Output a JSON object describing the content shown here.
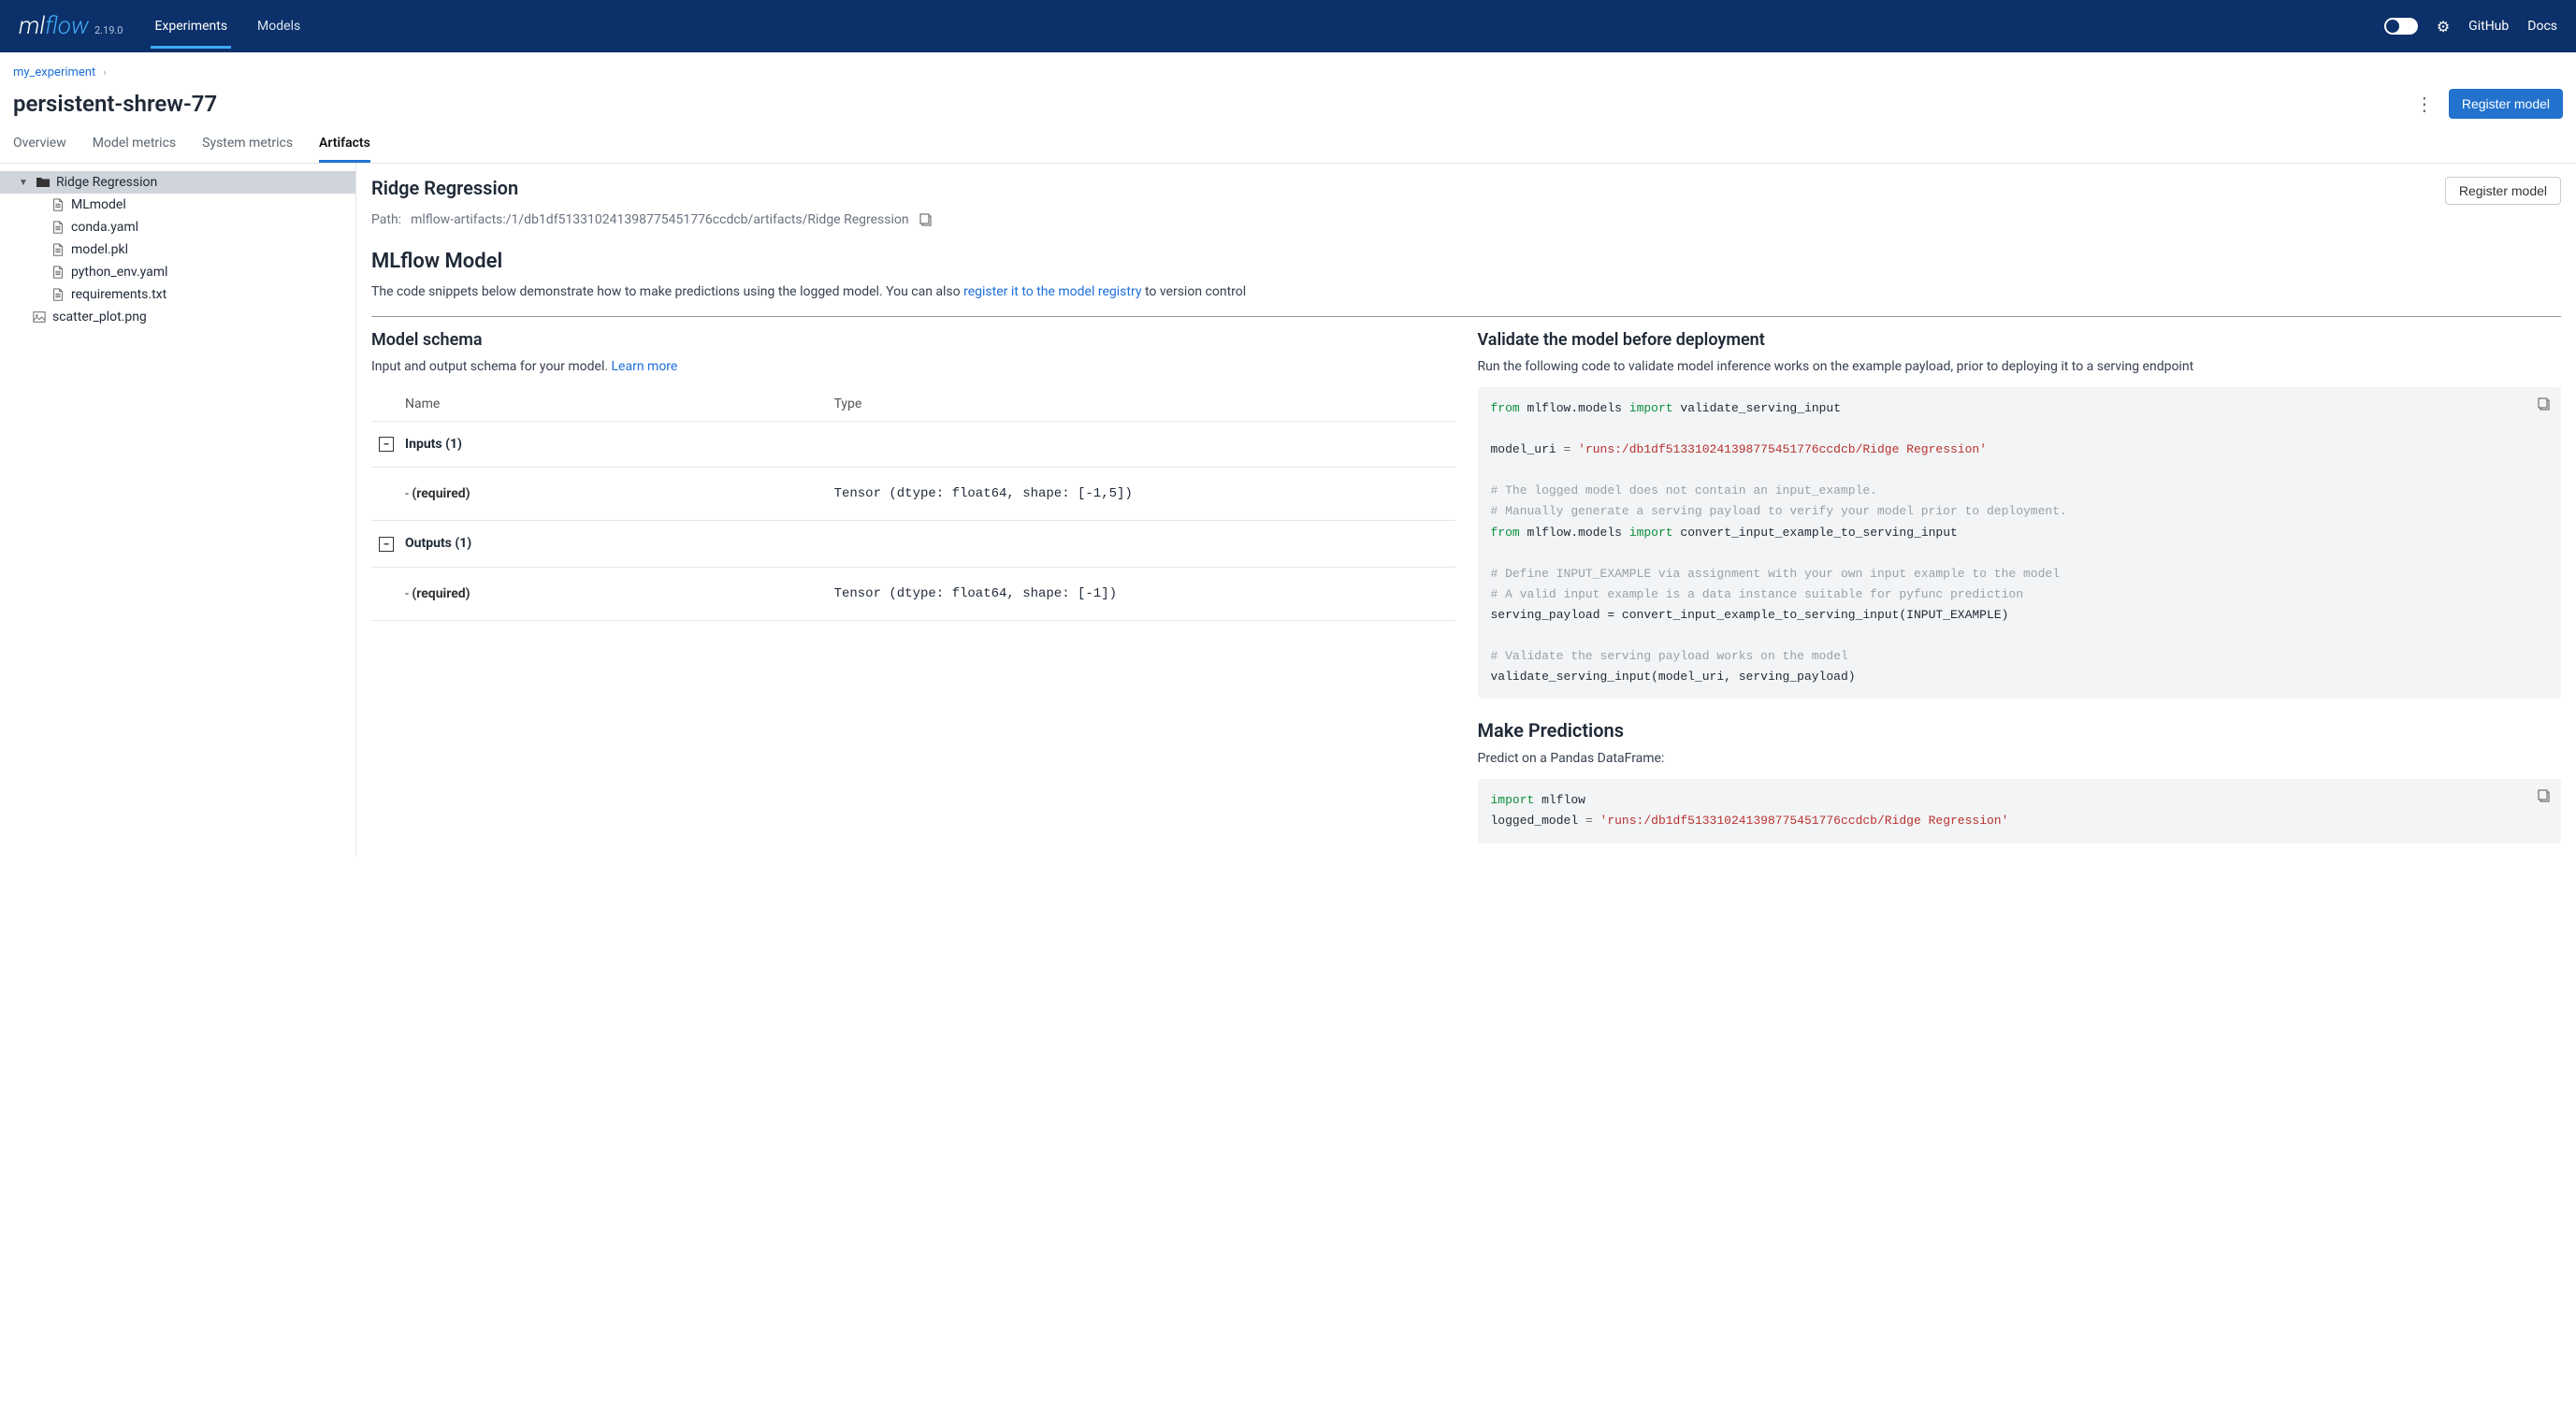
{
  "header": {
    "logo_ml": "ml",
    "logo_flow": "flow",
    "version": "2.19.0",
    "nav": {
      "experiments": "Experiments",
      "models": "Models"
    },
    "links": {
      "github": "GitHub",
      "docs": "Docs"
    }
  },
  "breadcrumb": {
    "parent": "my_experiment"
  },
  "run_name": "persistent-shrew-77",
  "register_button": "Register model",
  "tabs": {
    "overview": "Overview",
    "model_metrics": "Model metrics",
    "system_metrics": "System metrics",
    "artifacts": "Artifacts"
  },
  "tree": {
    "root": "Ridge Regression",
    "children": [
      "MLmodel",
      "conda.yaml",
      "model.pkl",
      "python_env.yaml",
      "requirements.txt"
    ],
    "extra_file": "scatter_plot.png"
  },
  "artifact": {
    "title": "Ridge Regression",
    "register_button": "Register model",
    "path_label": "Path:",
    "path": "mlflow-artifacts:/1/db1df513310241398775451776ccdcb/artifacts/Ridge Regression",
    "model_heading": "MLflow Model",
    "model_desc_a": "The code snippets below demonstrate how to make predictions using the logged model. You can also ",
    "model_desc_link": "register it to the model registry",
    "model_desc_b": " to version control"
  },
  "schema": {
    "heading": "Model schema",
    "sub_a": "Input and output schema for your model. ",
    "sub_link": "Learn more",
    "col_name": "Name",
    "col_type": "Type",
    "inputs_label": "Inputs (1)",
    "outputs_label": "Outputs (1)",
    "dash_required": "- (required)",
    "input_type": "Tensor (dtype: float64, shape: [-1,5])",
    "output_type": "Tensor (dtype: float64, shape: [-1])"
  },
  "validate": {
    "heading": "Validate the model before deployment",
    "sub": "Run the following code to validate model inference works on the example payload, prior to deploying it to a serving endpoint",
    "code": {
      "l1_from": "from",
      "l1_mod": "mlflow.models",
      "l1_import": "import",
      "l1_fn": "validate_serving_input",
      "l3_var": "model_uri",
      "l3_eq": " = ",
      "l3_str": "'runs:/db1df513310241398775451776ccdcb/Ridge Regression'",
      "c1": "# The logged model does not contain an input_example.",
      "c2": "# Manually generate a serving payload to verify your model prior to deployment.",
      "l6_from": "from",
      "l6_mod": "mlflow.models",
      "l6_import": "import",
      "l6_fn": "convert_input_example_to_serving_input",
      "c3": "# Define INPUT_EXAMPLE via assignment with your own input example to the model",
      "c4": "# A valid input example is a data instance suitable for pyfunc prediction",
      "l9": "serving_payload = convert_input_example_to_serving_input(INPUT_EXAMPLE)",
      "c5": "# Validate the serving payload works on the model",
      "l11": "validate_serving_input(model_uri, serving_payload)"
    }
  },
  "predict": {
    "heading": "Make Predictions",
    "sub": "Predict on a Pandas DataFrame:",
    "code": {
      "l1_import": "import",
      "l1_mod": "mlflow",
      "l2_var": "logged_model",
      "l2_eq": " = ",
      "l2_str": "'runs:/db1df513310241398775451776ccdcb/Ridge Regression'"
    }
  }
}
